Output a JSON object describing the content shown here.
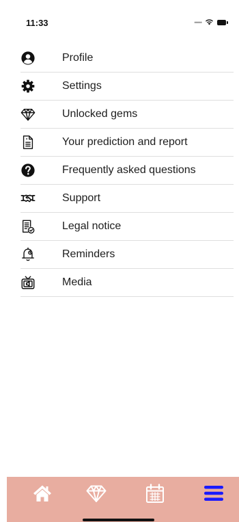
{
  "status_bar": {
    "time": "11:33"
  },
  "menu": {
    "items": [
      {
        "label": "Profile",
        "icon": "profile-icon"
      },
      {
        "label": "Settings",
        "icon": "gear-icon"
      },
      {
        "label": "Unlocked gems",
        "icon": "gem-icon"
      },
      {
        "label": "Your prediction and report",
        "icon": "document-icon"
      },
      {
        "label": "Frequently asked questions",
        "icon": "question-icon"
      },
      {
        "label": "Support",
        "icon": "handshake-icon"
      },
      {
        "label": "Legal notice",
        "icon": "legal-document-icon"
      },
      {
        "label": "Reminders",
        "icon": "bell-icon"
      },
      {
        "label": "Media",
        "icon": "tv-icon"
      }
    ]
  },
  "tab_bar": {
    "background": "#e8ada0",
    "inactive_color": "#ffffff",
    "active_color": "#1a1aff",
    "tabs": [
      {
        "icon": "home-icon",
        "active": false
      },
      {
        "icon": "gem-icon",
        "active": false
      },
      {
        "icon": "calendar-icon",
        "active": false
      },
      {
        "icon": "menu-icon",
        "active": true
      }
    ]
  }
}
